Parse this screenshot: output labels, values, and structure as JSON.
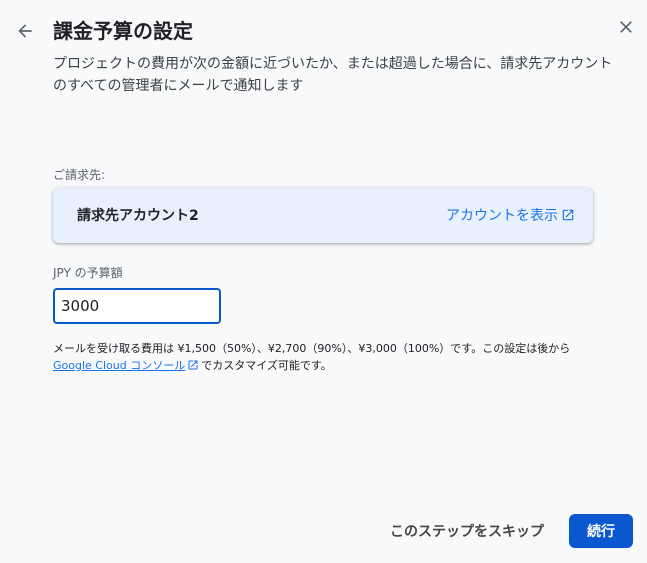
{
  "header": {
    "title": "課金予算の設定",
    "back_icon": "arrow-left-icon",
    "close_icon": "close-icon"
  },
  "description": "プロジェクトの費用が次の金額に近づいたか、または超過した場合に、請求先アカウントのすべての管理者にメールで通知します",
  "billing": {
    "label": "ご請求先:",
    "account_name": "請求先アカウント2",
    "view_link": "アカウントを表示",
    "link_icon": "open-in-new-icon"
  },
  "budget": {
    "label": "JPY の予算額",
    "value": "3000"
  },
  "note": {
    "text_before": "メールを受け取る費用は ¥1,500（50%）、¥2,700（90%）、¥3,000（100%）です。この設定は後から",
    "link": "Google Cloud コンソール",
    "text_after": "でカスタマイズ可能です。"
  },
  "actions": {
    "skip_label": "このステップをスキップ",
    "continue_label": "続行"
  },
  "colors": {
    "accent": "#0b57d0",
    "link": "#1a73e8",
    "card_bg": "#e8f0fe",
    "page_bg": "#f8f9fa"
  }
}
